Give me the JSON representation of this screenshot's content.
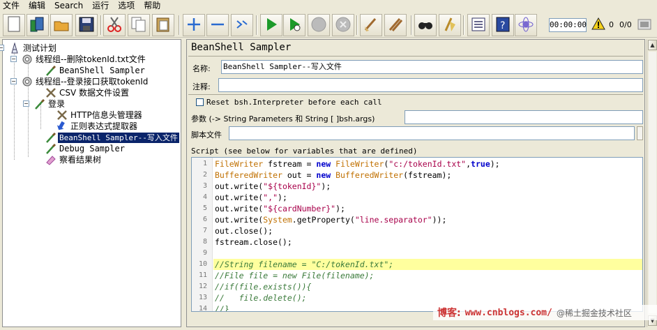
{
  "menu": [
    "文件",
    "编辑",
    "Search",
    "运行",
    "选项",
    "帮助"
  ],
  "toolbar": {
    "icons": [
      "new-icon",
      "templates-icon",
      "open-icon",
      "save-icon",
      "cut-icon",
      "copy-icon",
      "paste-icon",
      "expand-icon",
      "collapse-icon",
      "toggle-icon",
      "start-icon",
      "start-no-pause-icon",
      "stop-icon",
      "shutdown-icon",
      "clear-icon",
      "clear-all-icon",
      "search-icon",
      "reset-search-icon",
      "function-helper-icon",
      "help-icon",
      "remote-icon"
    ],
    "timer": "00:00:00",
    "warn_count": "0",
    "threads": "0/0"
  },
  "tree": {
    "items": [
      {
        "label": "测试计划",
        "icon": "test-plan-icon"
      },
      {
        "label": "线程组--删除tokenId.txt文件",
        "icon": "thread-group-icon"
      },
      {
        "label": "BeanShell Sampler",
        "icon": "pipette-icon"
      },
      {
        "label": "线程组--登录接口获取tokenId",
        "icon": "thread-group-icon"
      },
      {
        "label": "CSV 数据文件设置",
        "icon": "config-tools-icon"
      },
      {
        "label": "登录",
        "icon": "pipette-icon"
      },
      {
        "label": "HTTP信息头管理器",
        "icon": "config-tools-icon"
      },
      {
        "label": "正则表达式提取器",
        "icon": "arrow-icon"
      },
      {
        "label": "BeanShell Sampler--写入文件",
        "icon": "pipette-icon"
      },
      {
        "label": "Debug Sampler",
        "icon": "pipette-icon"
      },
      {
        "label": "察看结果树",
        "icon": "listener-icon"
      }
    ]
  },
  "panel": {
    "title": "BeanShell Sampler",
    "name_label": "名称:",
    "name_value": "BeanShell Sampler--写入文件",
    "comment_label": "注释:",
    "comment_value": "",
    "reset_label": "Reset bsh.Interpreter before each call",
    "params_label": "参数 (-> String Parameters 和 String [ ]bsh.args)",
    "params_value": "",
    "script_file_label": "脚本文件",
    "script_file_value": "",
    "script_label": "Script (see below for variables that are defined)"
  },
  "script": {
    "lines": [
      "FileWriter fstream = new FileWriter(\"c:/tokenId.txt\",true);",
      "BufferedWriter out = new BufferedWriter(fstream);",
      "out.write(\"${tokenId}\");",
      "out.write(\",\");",
      "out.write(\"${cardNumber}\");",
      "out.write(System.getProperty(\"line.separator\"));",
      "out.close();",
      "fstream.close();",
      "",
      "//String filename = \"C:/tokenId.txt\";",
      "//File file = new File(filename);",
      "//if(file.exists()){",
      "//   file.delete();",
      "//}"
    ],
    "highlight_line": 10
  },
  "watermark": {
    "prefix": "博客:",
    "url": "www.cnblogs.com/",
    "overlay": "@稀土掘金技术社区"
  }
}
